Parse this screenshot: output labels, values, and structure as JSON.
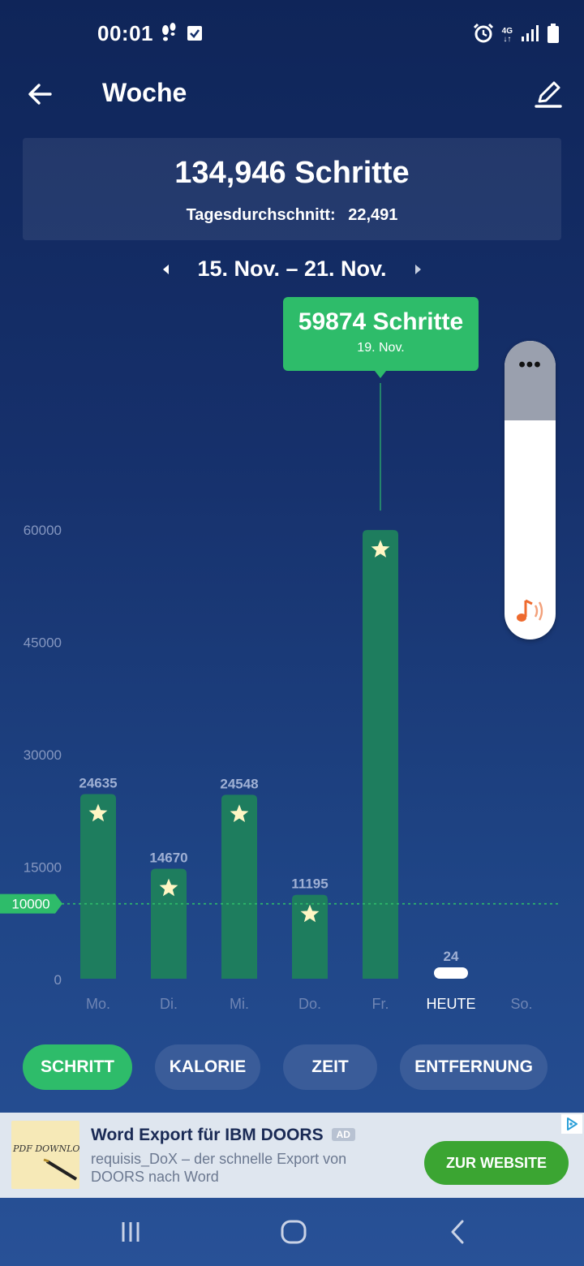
{
  "status_bar": {
    "time": "00:01",
    "network": "4G",
    "icons": [
      "footprints-icon",
      "checkbox-icon",
      "alarm-icon",
      "network-4g-icon",
      "signal-icon",
      "battery-icon"
    ]
  },
  "header": {
    "title": "Woche",
    "back_icon": "arrow-left-icon",
    "edit_icon": "pencil-icon"
  },
  "summary": {
    "total": "134,946 Schritte",
    "average_label": "Tagesdurchschnitt:",
    "average_value": "22,491"
  },
  "date_nav": {
    "range": "15. Nov. – 21. Nov."
  },
  "tooltip": {
    "value": "59874 Schritte",
    "date": "19. Nov."
  },
  "side_panel": {
    "dots": "•••",
    "icon": "music-note-icon"
  },
  "chart_data": {
    "type": "bar",
    "categories": [
      "Mo.",
      "Di.",
      "Mi.",
      "Do.",
      "Fr.",
      "HEUTE",
      "So."
    ],
    "values": [
      24635,
      14670,
      24548,
      11195,
      59874,
      24,
      null
    ],
    "value_labels": [
      "24635",
      "14670",
      "24548",
      "11195",
      "",
      "24",
      ""
    ],
    "starred": [
      true,
      true,
      true,
      true,
      true,
      false,
      false
    ],
    "y_ticks": [
      0,
      15000,
      30000,
      45000,
      60000
    ],
    "ylim": [
      0,
      60000
    ],
    "goal": 10000,
    "goal_label": "10000",
    "selected_index": 4,
    "highlight_category": "HEUTE",
    "colors": {
      "bar": "#1e7d5e",
      "goal_line": "#2ebc6a",
      "star": "#fff6c4"
    }
  },
  "tabs": [
    {
      "label": "SCHRITT",
      "active": true
    },
    {
      "label": "KALORIE",
      "active": false
    },
    {
      "label": "ZEIT",
      "active": false
    },
    {
      "label": "ENTFERNUNG",
      "active": false
    }
  ],
  "ad": {
    "thumbnail_text": "PDF DOWNLOAD",
    "title": "Word Export für IBM DOORS",
    "badge": "AD",
    "description": "requisis_DoX – der schnelle Export von DOORS nach Word",
    "cta": "ZUR WEBSITE"
  },
  "nav_bar": {
    "icons": [
      "recent-apps-icon",
      "home-icon",
      "back-icon"
    ]
  },
  "colors": {
    "accent": "#2ebc6a",
    "background_top": "#0f2559",
    "background_bottom": "#285197",
    "tab_inactive": "#3a5c99",
    "ad_cta": "#3ba532"
  }
}
